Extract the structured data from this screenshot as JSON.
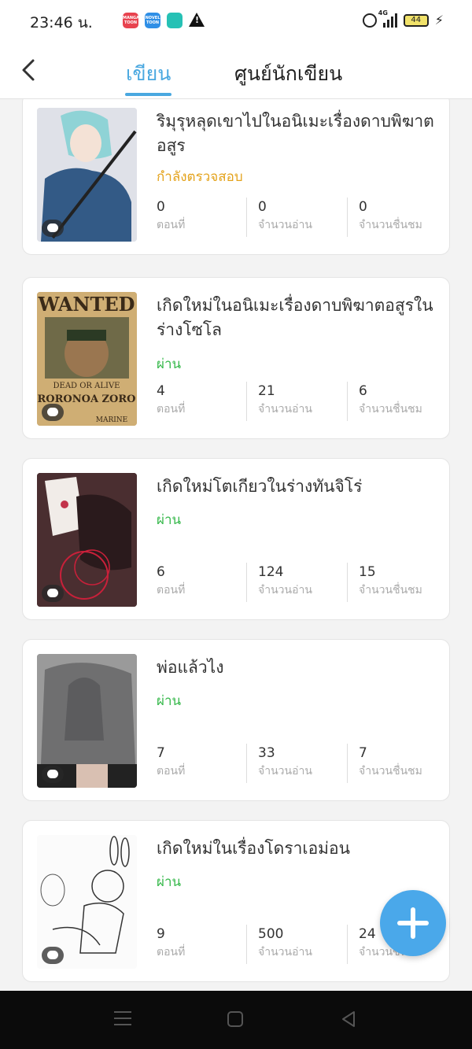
{
  "status_bar": {
    "time": "23:46 น.",
    "notif_icons": [
      "mangatoon-icon",
      "noveltoon-icon",
      "chat-app-icon",
      "warning-icon"
    ],
    "manga_label": "MANGA TOON",
    "novel_label": "NOVEL TOON",
    "network": "4G",
    "battery": "44"
  },
  "header": {
    "tabs": [
      {
        "label": "เขียน",
        "active": true
      },
      {
        "label": "ศูนย์นักเขียน",
        "active": false
      }
    ]
  },
  "colors": {
    "accent": "#4aa8e0",
    "pending": "#e4a31c",
    "pass": "#35b84a"
  },
  "stat_labels": {
    "episodes": "ตอนที่",
    "reads": "จำนวนอ่าน",
    "likes": "จำนวนชื่นชม"
  },
  "works": [
    {
      "title": "ริมุรุหลุดเขาไปในอนิเมะเรื่องดาบพิฆาตอสูร",
      "status": "กำลังตรวจสอบ",
      "status_type": "pending",
      "episodes": "0",
      "reads": "0",
      "likes": "0"
    },
    {
      "title": "เกิดใหม่ในอนิเมะเรื่องดาบพิฆาตอสูรในร่างโซโล",
      "status": "ผ่าน",
      "status_type": "pass",
      "episodes": "4",
      "reads": "21",
      "likes": "6",
      "cover_text": {
        "top": "WANTED",
        "mid": "DEAD OR ALIVE",
        "name": "RORONOA ZORO",
        "bottom": "MARINE"
      }
    },
    {
      "title": "เกิดใหม่โตเกียวในร่างทันจิโร่",
      "status": "ผ่าน",
      "status_type": "pass",
      "episodes": "6",
      "reads": "124",
      "likes": "15"
    },
    {
      "title": "พ่อแล้วไง",
      "status": "ผ่าน",
      "status_type": "pass",
      "episodes": "7",
      "reads": "33",
      "likes": "7"
    },
    {
      "title": "เกิดใหม่ในเรื่องโดราเอม่อน",
      "status": "ผ่าน",
      "status_type": "pass",
      "episodes": "9",
      "reads": "500",
      "likes": "24"
    }
  ]
}
